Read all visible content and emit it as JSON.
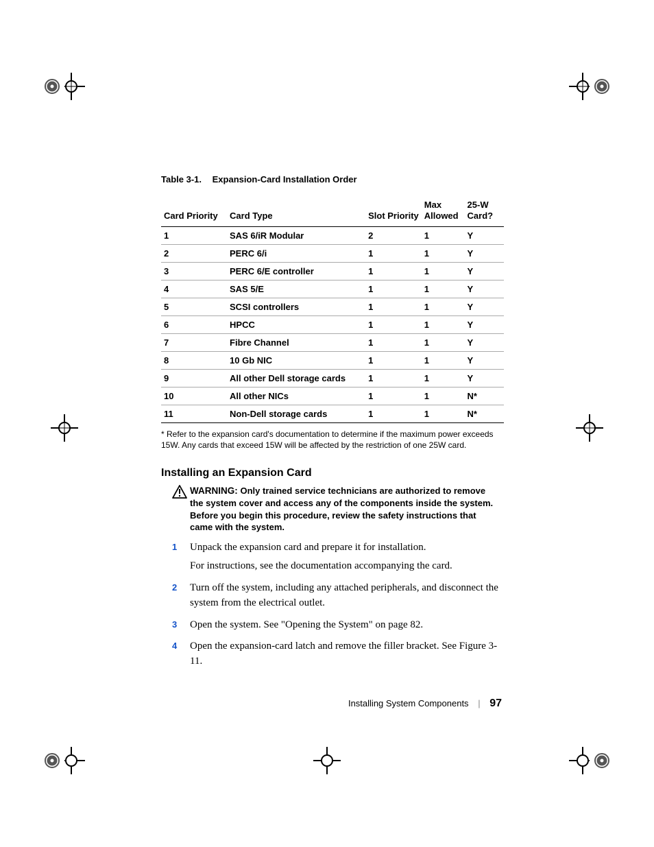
{
  "table": {
    "caption_no": "Table 3-1.",
    "caption_txt": "Expansion-Card Installation Order",
    "headers": {
      "cp": "Card Priority",
      "ct": "Card Type",
      "sp": "Slot Priority",
      "ma_l1": "Max",
      "ma_l2": "Allowed",
      "w_l1": "25-W",
      "w_l2": "Card?"
    },
    "rows": [
      {
        "cp": "1",
        "ct": "SAS 6/iR Modular",
        "sp": "2",
        "ma": "1",
        "w": "Y"
      },
      {
        "cp": "2",
        "ct": "PERC 6/i",
        "sp": "1",
        "ma": "1",
        "w": "Y"
      },
      {
        "cp": "3",
        "ct": "PERC 6/E controller",
        "sp": "1",
        "ma": "1",
        "w": "Y"
      },
      {
        "cp": "4",
        "ct": "SAS 5/E",
        "sp": "1",
        "ma": "1",
        "w": "Y"
      },
      {
        "cp": "5",
        "ct": "SCSI controllers",
        "sp": "1",
        "ma": "1",
        "w": "Y"
      },
      {
        "cp": "6",
        "ct": "HPCC",
        "sp": "1",
        "ma": "1",
        "w": "Y"
      },
      {
        "cp": "7",
        "ct": "Fibre Channel",
        "sp": "1",
        "ma": "1",
        "w": "Y"
      },
      {
        "cp": "8",
        "ct": "10 Gb NIC",
        "sp": "1",
        "ma": "1",
        "w": "Y"
      },
      {
        "cp": "9",
        "ct": "All other Dell storage cards",
        "sp": "1",
        "ma": "1",
        "w": "Y"
      },
      {
        "cp": "10",
        "ct": "All other NICs",
        "sp": "1",
        "ma": "1",
        "w": "N*"
      },
      {
        "cp": "11",
        "ct": "Non-Dell storage cards",
        "sp": "1",
        "ma": "1",
        "w": "N*"
      }
    ],
    "footnote": "* Refer to the expansion card's documentation to determine if the maximum power exceeds 15W. Any cards that exceed 15W will be affected by the restriction of one 25W card."
  },
  "section": {
    "heading": "Installing an Expansion Card",
    "warn_label": "WARNING: ",
    "warn_body": "Only trained service technicians are authorized to remove the system cover and access any of the components inside the system. Before you begin this procedure, review the safety instructions that came with the system.",
    "steps": [
      {
        "n": "1",
        "t": "Unpack the expansion card and prepare it for installation.",
        "sub": "For instructions, see the documentation accompanying the card."
      },
      {
        "n": "2",
        "t": "Turn off the system, including any attached peripherals, and disconnect the system from the electrical outlet."
      },
      {
        "n": "3",
        "t": "Open the system. See \"Opening the System\" on page 82."
      },
      {
        "n": "4",
        "t": "Open the expansion-card latch and remove the filler bracket. See Figure 3-11."
      }
    ]
  },
  "footer": {
    "section": "Installing System Components",
    "page": "97"
  }
}
